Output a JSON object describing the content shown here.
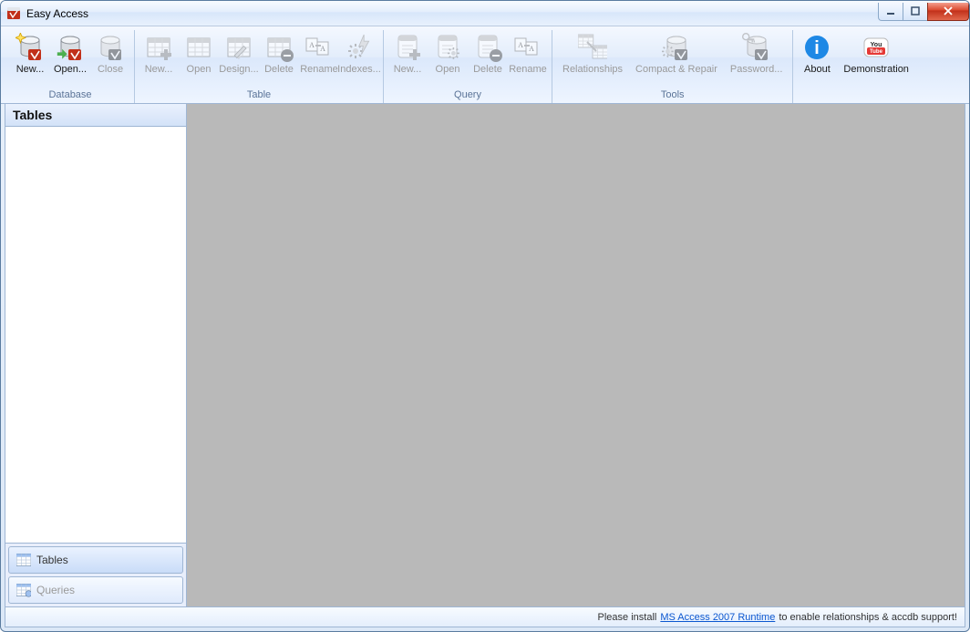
{
  "window": {
    "title": "Easy Access"
  },
  "ribbon": {
    "groups": [
      {
        "label": "Database",
        "items": [
          {
            "label": "New...",
            "name": "db-new-button",
            "icon": "db-new",
            "enabled": true
          },
          {
            "label": "Open...",
            "name": "db-open-button",
            "icon": "db-open",
            "enabled": true
          },
          {
            "label": "Close",
            "name": "db-close-button",
            "icon": "db-close",
            "enabled": false
          }
        ]
      },
      {
        "label": "Table",
        "items": [
          {
            "label": "New...",
            "name": "table-new-button",
            "icon": "tbl-new",
            "enabled": false
          },
          {
            "label": "Open",
            "name": "table-open-button",
            "icon": "tbl-open",
            "enabled": false
          },
          {
            "label": "Design...",
            "name": "table-design-button",
            "icon": "tbl-design",
            "enabled": false
          },
          {
            "label": "Delete",
            "name": "table-delete-button",
            "icon": "tbl-delete",
            "enabled": false
          },
          {
            "label": "Rename",
            "name": "table-rename-button",
            "icon": "rename",
            "enabled": false
          },
          {
            "label": "Indexes...",
            "name": "table-indexes-button",
            "icon": "indexes",
            "enabled": false
          }
        ]
      },
      {
        "label": "Query",
        "items": [
          {
            "label": "New...",
            "name": "query-new-button",
            "icon": "qry-new",
            "enabled": false
          },
          {
            "label": "Open",
            "name": "query-open-button",
            "icon": "qry-open",
            "enabled": false
          },
          {
            "label": "Delete",
            "name": "query-delete-button",
            "icon": "qry-delete",
            "enabled": false
          },
          {
            "label": "Rename",
            "name": "query-rename-button",
            "icon": "rename",
            "enabled": false
          }
        ]
      },
      {
        "label": "Tools",
        "items": [
          {
            "label": "Relationships",
            "name": "relationships-button",
            "icon": "relationships",
            "enabled": false,
            "wide": true
          },
          {
            "label": "Compact & Repair",
            "name": "compact-repair-button",
            "icon": "compact",
            "enabled": false,
            "wide": true
          },
          {
            "label": "Password...",
            "name": "password-button",
            "icon": "password",
            "enabled": false,
            "wide": true
          }
        ]
      },
      {
        "label": "",
        "items": [
          {
            "label": "About",
            "name": "about-button",
            "icon": "about",
            "enabled": true
          },
          {
            "label": "Demonstration",
            "name": "demonstration-button",
            "icon": "youtube",
            "enabled": true,
            "wide": true
          }
        ]
      }
    ]
  },
  "sidebar": {
    "header": "Tables",
    "tabs": [
      {
        "label": "Tables",
        "name": "sidebar-tab-tables",
        "icon": "table-icon",
        "selected": true,
        "enabled": true
      },
      {
        "label": "Queries",
        "name": "sidebar-tab-queries",
        "icon": "query-icon",
        "selected": false,
        "enabled": false
      }
    ]
  },
  "statusbar": {
    "prefix": "Please install",
    "link_text": "MS Access 2007 Runtime",
    "suffix": "to enable relationships & accdb support!"
  }
}
